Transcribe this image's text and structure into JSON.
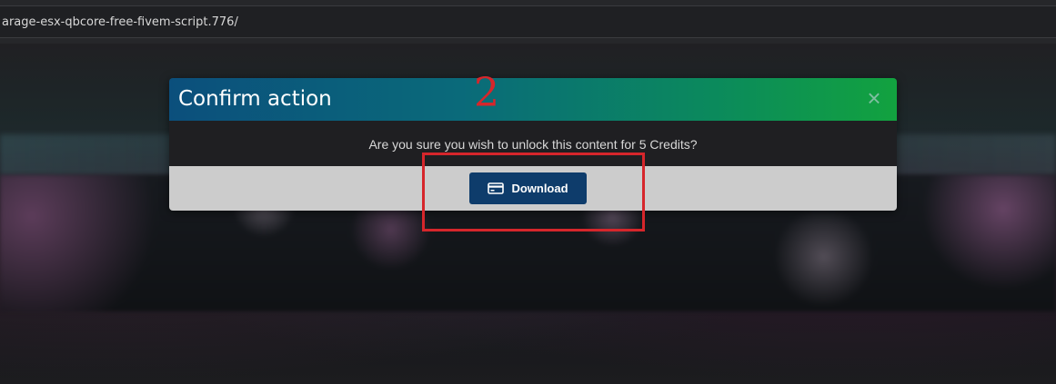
{
  "browser": {
    "address_text": "arage-esx-qbcore-free-fivem-script.776/"
  },
  "dialog": {
    "title": "Confirm action",
    "close_glyph": "×",
    "message": "Are you sure you wish to unlock this content for 5 Credits?",
    "primary_button_label": "Download",
    "primary_button_icon": "credit-card-icon"
  },
  "annotation": {
    "step_number": "2",
    "color": "#d6262b"
  },
  "colors": {
    "header_gradient_start": "#0b4f7c",
    "header_gradient_end": "#12a23f",
    "button_bg": "#0e3c6b",
    "footer_bg": "#cccccc"
  }
}
